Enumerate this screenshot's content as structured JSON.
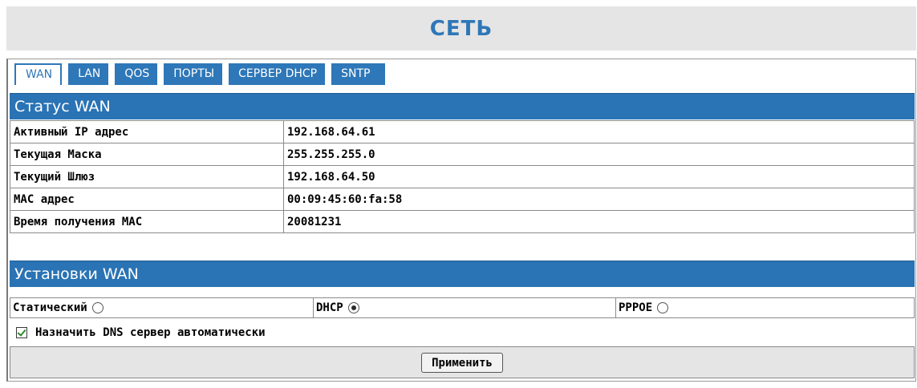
{
  "page_title": "СЕТЬ",
  "tabs": [
    {
      "label": "WAN",
      "active": true
    },
    {
      "label": "LAN",
      "active": false
    },
    {
      "label": "QOS",
      "active": false
    },
    {
      "label": "ПОРТЫ",
      "active": false
    },
    {
      "label": "СЕРВЕР DHCP",
      "active": false
    },
    {
      "label": "SNTP",
      "active": false
    }
  ],
  "wan_status": {
    "header": "Статус WAN",
    "rows": [
      {
        "label": "Активный IP адрес",
        "value": "192.168.64.61"
      },
      {
        "label": "Текущая Маска",
        "value": "255.255.255.0"
      },
      {
        "label": "Текущий Шлюз",
        "value": "192.168.64.50"
      },
      {
        "label": "MAC адрес",
        "value": "00:09:45:60:fa:58"
      },
      {
        "label": "Время получения MAC",
        "value": "20081231"
      }
    ]
  },
  "wan_settings": {
    "header": "Установки WAN",
    "modes": [
      {
        "label": "Статический",
        "selected": false
      },
      {
        "label": "DHCP",
        "selected": true
      },
      {
        "label": "PPPOE",
        "selected": false
      }
    ],
    "dns_auto_label": "Назначить DNS сервер автоматически",
    "dns_auto_checked": true,
    "apply_label": "Применить"
  },
  "colors": {
    "accent": "#2e77b8",
    "header_bg": "#2a73b4",
    "panel_bg": "#e5e5e5"
  }
}
